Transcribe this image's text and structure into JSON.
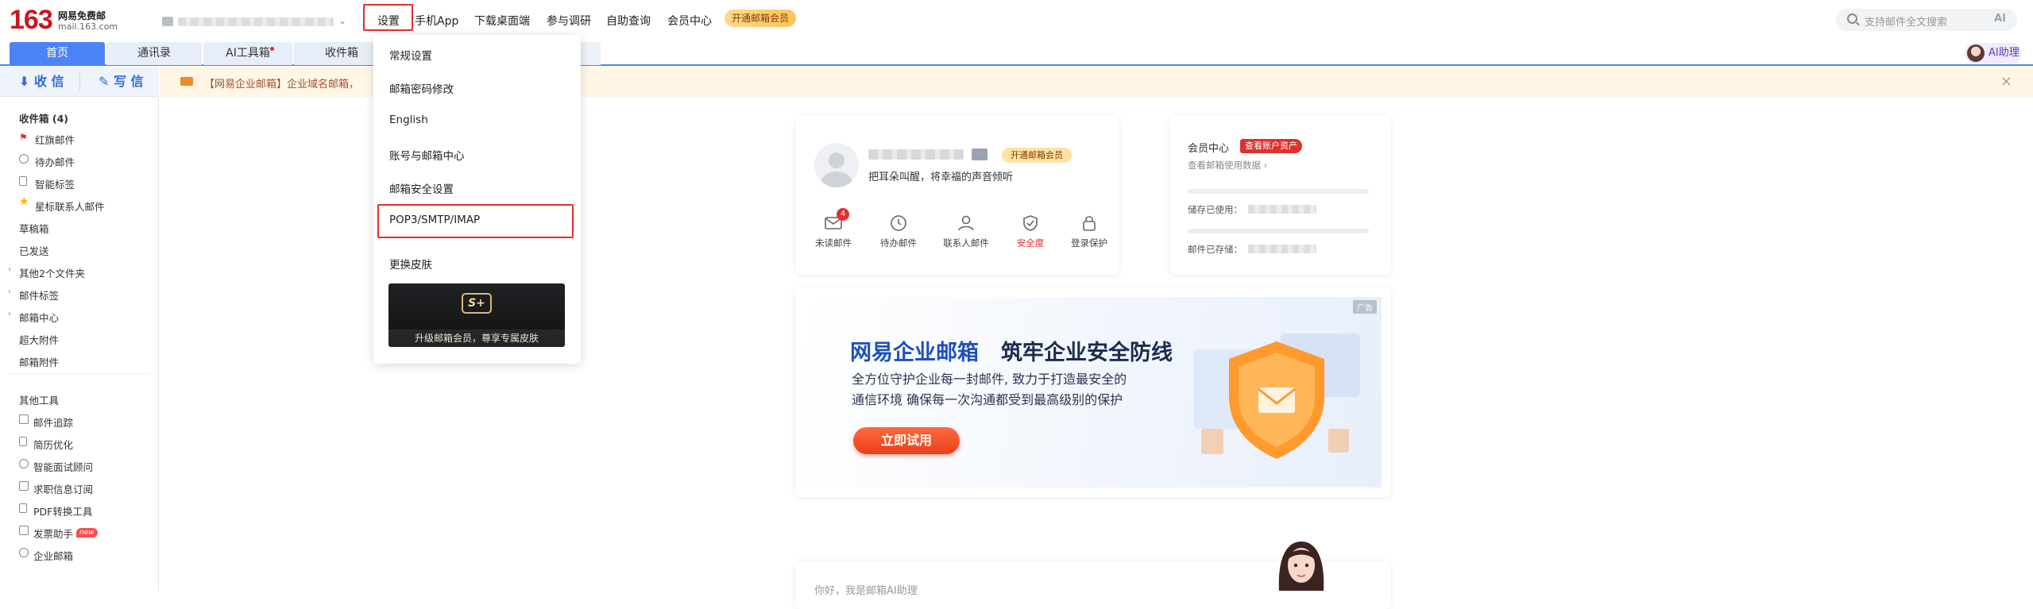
{
  "header": {
    "logo_number": "163",
    "logo_title": "网易免费邮",
    "logo_domain": "mail.163.com",
    "nav": {
      "settings": "设置",
      "mobile_app": "手机App",
      "desktop_client": "下载桌面端",
      "survey": "参与调研",
      "self_service": "自助查询",
      "member_center": "会员中心"
    },
    "vip_button": "开通邮箱会员",
    "search_placeholder": "支持邮件全文搜索",
    "search_ai": "AI"
  },
  "tabs": [
    {
      "label": "首页",
      "active": true
    },
    {
      "label": "通讯录",
      "active": false
    },
    {
      "label": "AI工具箱",
      "active": false,
      "dot": true
    },
    {
      "label": "收件箱",
      "active": false
    }
  ],
  "ai_assistant": "AI助理",
  "sidebar": {
    "receive": "收 信",
    "write": "写 信",
    "folders": [
      {
        "label": "收件箱 (4)"
      },
      {
        "label": "红旗邮件"
      },
      {
        "label": "待办邮件"
      },
      {
        "label": "智能标签"
      },
      {
        "label": "星标联系人邮件"
      },
      {
        "label": "草稿箱"
      },
      {
        "label": "已发送"
      },
      {
        "label": "其他2个文件夹"
      },
      {
        "label": "邮件标签"
      },
      {
        "label": "邮箱中心"
      },
      {
        "label": "超大附件"
      },
      {
        "label": "邮箱附件"
      }
    ],
    "tools_title": "其他工具",
    "tools": [
      {
        "label": "邮件追踪"
      },
      {
        "label": "简历优化"
      },
      {
        "label": "智能面试顾问"
      },
      {
        "label": "求职信息订阅"
      },
      {
        "label": "PDF转换工具"
      },
      {
        "label": "发票助手",
        "badge": "new"
      },
      {
        "label": "企业邮箱"
      }
    ]
  },
  "notice": {
    "text": "【网易企业邮箱】企业域名邮箱，"
  },
  "profile": {
    "vip": "开通邮箱会员",
    "motto": "把耳朵叫醒，将幸福的声音倾听",
    "actions": [
      {
        "label": "未读邮件",
        "count": "4",
        "icon": "envelope-icon"
      },
      {
        "label": "待办邮件",
        "icon": "clock-icon"
      },
      {
        "label": "联系人邮件",
        "icon": "contact-icon"
      },
      {
        "label": "安全度",
        "icon": "shield-icon",
        "color": "#e02f2f"
      },
      {
        "label": "登录保护",
        "icon": "lock-icon"
      }
    ]
  },
  "member": {
    "title": "会员中心",
    "tag": "查看账户资产",
    "link": "查看邮箱使用数据 ›",
    "used_label": "储存已使用：",
    "stored_label": "邮件已存储："
  },
  "banner": {
    "ad_tag": "广告",
    "title_brand": "网易企业邮箱",
    "title_rest": "筑牢企业安全防线",
    "desc1": "全方位守护企业每一封邮件, 致力于打造最安全的",
    "desc2": "通信环境 确保每一次沟通都受到最高级别的保护",
    "cta": "立即试用"
  },
  "ai_card": {
    "text": "你好，我是邮箱AI助理"
  },
  "dropdown": {
    "items": [
      "常规设置",
      "邮箱密码修改",
      "English",
      "账号与邮箱中心",
      "邮箱安全设置",
      "POP3/SMTP/IMAP",
      "更换皮肤"
    ],
    "skin_logo": "S+",
    "skin_caption": "升级邮箱会员，尊享专属皮肤"
  }
}
